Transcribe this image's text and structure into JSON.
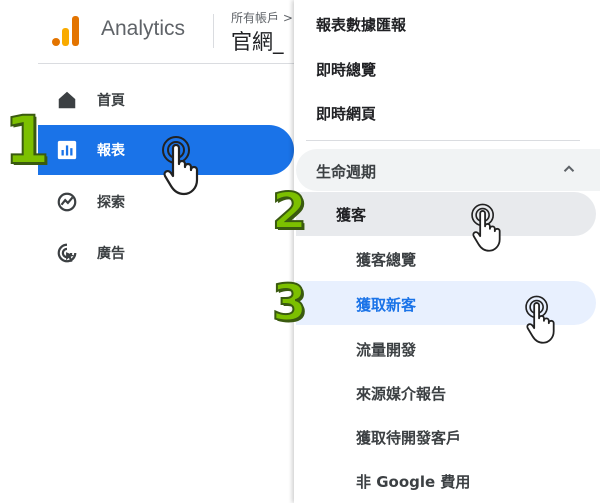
{
  "header": {
    "app_name": "Analytics",
    "account_label": "所有帳戶 >",
    "property_name": "官網_"
  },
  "sidebar": {
    "items": [
      {
        "label": "首頁",
        "icon": "home-icon",
        "active": false
      },
      {
        "label": "報表",
        "icon": "reports-icon",
        "active": true
      },
      {
        "label": "探索",
        "icon": "explore-icon",
        "active": false
      },
      {
        "label": "廣告",
        "icon": "advertising-icon",
        "active": false
      }
    ]
  },
  "submenu": {
    "top_items": [
      "報表數據匯報",
      "即時總覽",
      "即時網頁"
    ],
    "section": {
      "label": "生命週期",
      "expanded": true
    },
    "group": {
      "label": "獲客"
    },
    "children": [
      "獲客總覽",
      "獲取新客",
      "流量開發",
      "來源媒介報告",
      "獲取待開發客戶",
      "非 Google 費用"
    ]
  },
  "steps": [
    "1",
    "2",
    "3"
  ],
  "colors": {
    "accent": "#1a73e8",
    "badge_fill": "#7cc000",
    "highlight_blue": "#e8f0fe",
    "logo_orange": "#e37400",
    "logo_yellow": "#f9ab00"
  }
}
